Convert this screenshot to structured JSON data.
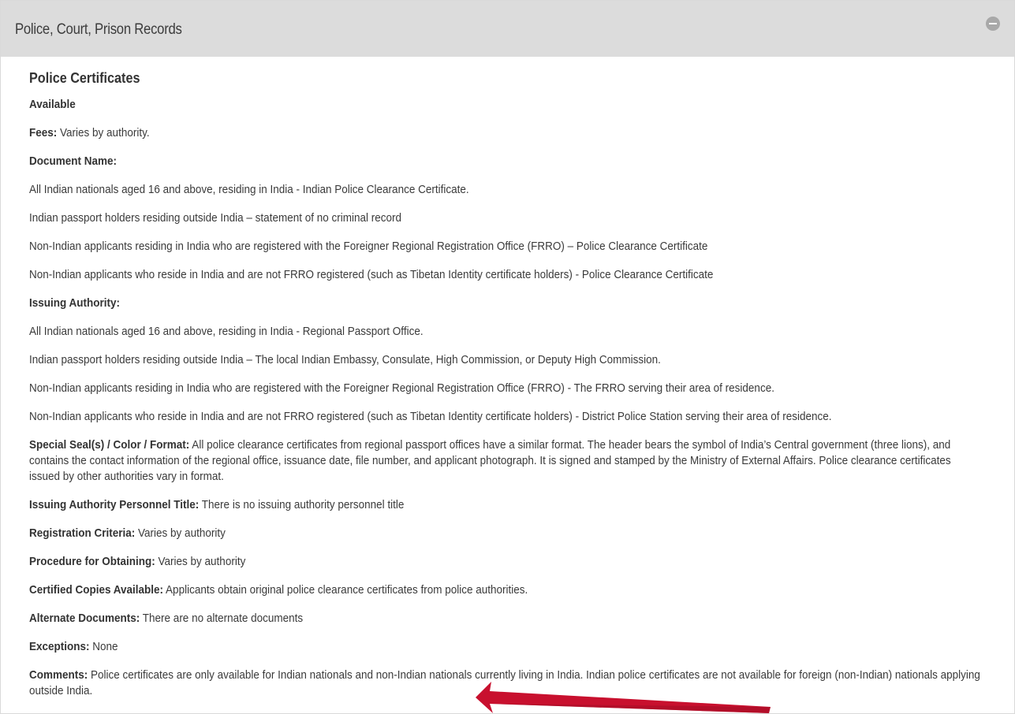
{
  "panel": {
    "title": "Police, Court, Prison Records",
    "collapse_icon": "minus-circle-icon"
  },
  "section": {
    "title": "Police Certificates",
    "availability": "Available",
    "fees_label": "Fees:",
    "fees_value": "Varies by authority.",
    "document_name_label": "Document Name:",
    "document_names": [
      "All Indian nationals aged 16 and above, residing in India - Indian Police Clearance Certificate.",
      "Indian passport holders residing outside India – statement of no criminal record",
      "Non-Indian applicants residing in India who are registered with the Foreigner Regional Registration Office (FRRO) – Police Clearance Certificate",
      "Non-Indian applicants who reside in India and are not FRRO registered (such as Tibetan Identity certificate holders) - Police Clearance Certificate"
    ],
    "issuing_authority_label": "Issuing Authority:",
    "issuing_authorities": [
      "All Indian nationals aged 16 and above, residing in India - Regional Passport Office.",
      "Indian passport holders residing outside India – The local Indian Embassy, Consulate, High Commission, or Deputy High Commission.",
      "Non-Indian applicants residing in India who are registered with the Foreigner Regional Registration Office (FRRO) - The FRRO serving their area of residence.",
      "Non-Indian applicants who reside in India and are not FRRO registered (such as Tibetan Identity certificate holders) - District Police Station serving their area of residence."
    ],
    "seal_label": "Special Seal(s) / Color / Format:",
    "seal_value": "All police clearance certificates from regional passport offices have a similar format.  The header bears the symbol of India’s Central government (three lions), and contains the contact information of the regional office, issuance date, file number, and applicant photograph.  It is signed and stamped by the Ministry of External Affairs.  Police clearance certificates issued by other authorities vary in format.",
    "personnel_label": "Issuing Authority Personnel Title:",
    "personnel_value": "There is no issuing authority personnel title",
    "registration_label": "Registration Criteria:",
    "registration_value": "Varies by authority",
    "procedure_label": "Procedure for Obtaining:",
    "procedure_value": "Varies by authority",
    "copies_label": "Certified Copies Available:",
    "copies_value": "Applicants obtain original police clearance certificates from police authorities.",
    "alternate_label": "Alternate Documents:",
    "alternate_value": "There are no alternate documents",
    "exceptions_label": "Exceptions:",
    "exceptions_value": "None",
    "comments_label": "Comments:",
    "comments_value": "Police certificates are only available for Indian nationals and non-Indian nationals currently living in India. Indian police certificates are not available for foreign (non-Indian) nationals applying outside India."
  },
  "annotation": {
    "arrow_icon": "red-arrow-icon",
    "arrow_color": "#c8102e"
  },
  "colors": {
    "header_bg": "#dcdcdc",
    "text": "#3a3a3a"
  }
}
